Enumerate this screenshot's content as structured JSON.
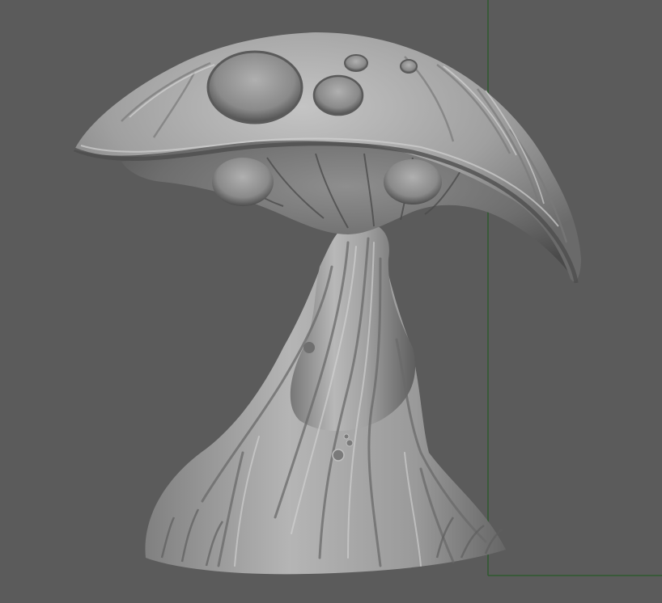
{
  "viewport": {
    "background": "#5b5b5b",
    "guide_color": "#2f5a2f"
  },
  "model": {
    "subject": "mushroom-sculpt",
    "material": "matcap-gray",
    "base_color": "#9a9a9a",
    "highlight_color": "#cfcfcf",
    "shadow_color": "#3a3a3a"
  }
}
